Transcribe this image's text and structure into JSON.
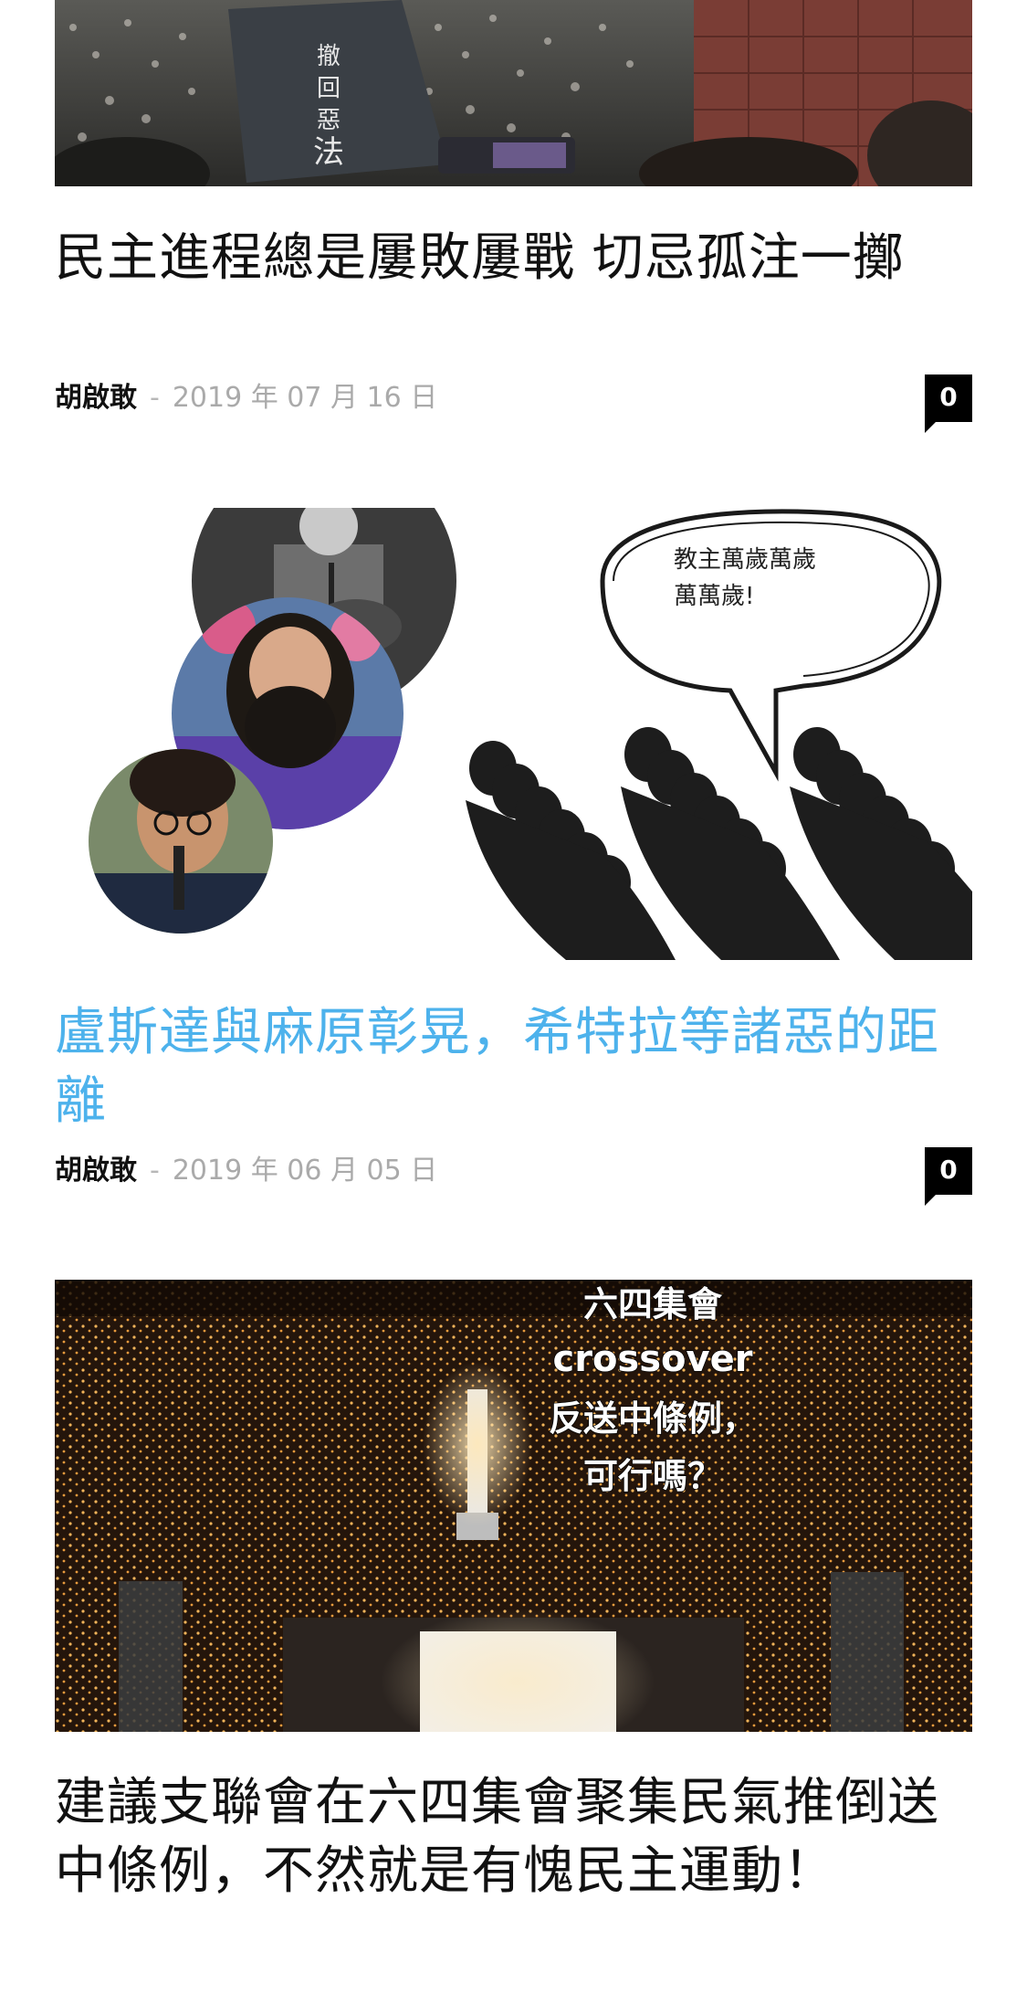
{
  "articles": [
    {
      "image_alt": "protest-crowd-banner",
      "title": "民主進程總是屢敗屢戰 切忌孤注一擲",
      "author": "胡啟敢",
      "separator": "-",
      "date": "2019 年 07 月 16 日",
      "comments": "0",
      "highlighted": false
    },
    {
      "image_alt": "cult-leaders-cartoon",
      "title": "盧斯達與麻原彰晃，希特拉等諸惡的距離",
      "author": "胡啟敢",
      "separator": "-",
      "date": "2019 年 06 月 05 日",
      "comments": "0",
      "highlighted": true,
      "speech_bubble": "教主萬歲萬歲\n萬萬歲!"
    },
    {
      "image_alt": "candlelight-vigil",
      "title": "建議支聯會在六四集會聚集民氣推倒送中條例，不然就是有愧民主運動！",
      "image_caption": [
        "六四集會",
        "crossover",
        "反送中條例，",
        "可行嗎？"
      ],
      "highlighted": false
    }
  ],
  "colors": {
    "title": "#111111",
    "title_highlight": "#4db2ec",
    "date": "#aaaaaa",
    "comment_badge": "#000000"
  }
}
